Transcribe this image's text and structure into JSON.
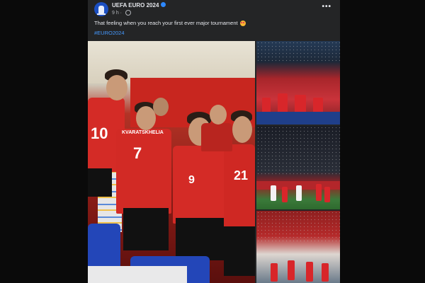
{
  "post": {
    "page_name": "UEFA EURO 2024",
    "timestamp": "9 h",
    "caption": "That feeling when you reach your first ever major tournament",
    "hashtag": "#EURO2024"
  },
  "photos": {
    "main": {
      "jersey_names": [
        "KVARATSKHELIA"
      ],
      "jersey_numbers": [
        "10",
        "7",
        "9",
        "21"
      ]
    }
  },
  "colors": {
    "post_bg": "#242526",
    "text_primary": "#e4e6eb",
    "text_secondary": "#b0b3b8",
    "link": "#4599ff",
    "avatar": "#1b4fc2"
  },
  "icons": [
    "uefa-trophy-icon",
    "verified-icon",
    "globe-icon",
    "more-options-icon",
    "heart-eyes-emoji-icon"
  ]
}
